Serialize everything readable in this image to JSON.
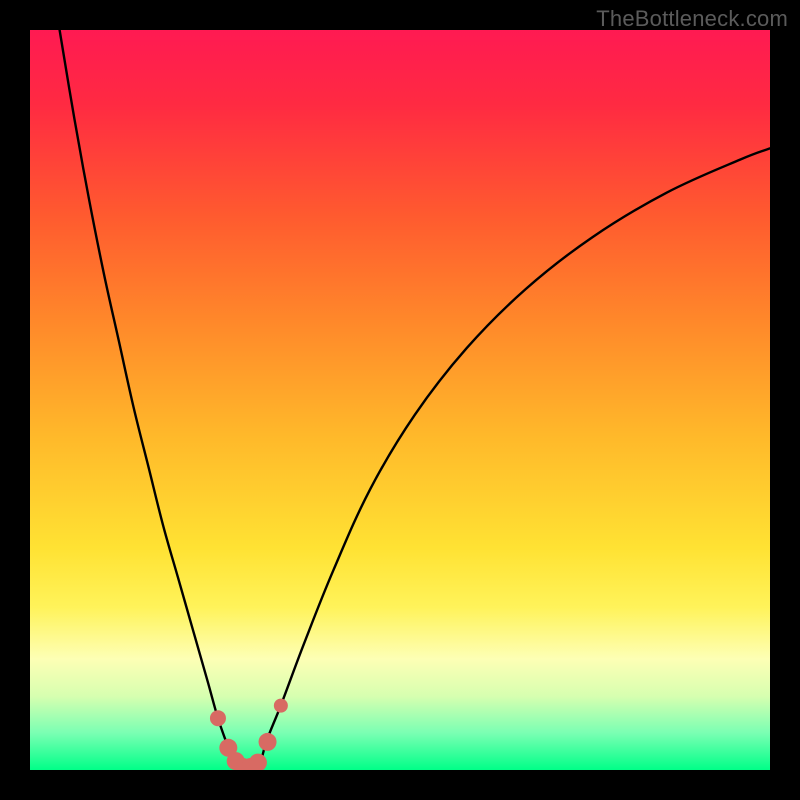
{
  "watermark": "TheBottleneck.com",
  "colors": {
    "frame": "#000000",
    "curve": "#000000",
    "marker": "#d86a63",
    "gradient_stops": [
      {
        "offset": 0.0,
        "color": "#ff1a52"
      },
      {
        "offset": 0.1,
        "color": "#ff2a42"
      },
      {
        "offset": 0.25,
        "color": "#ff5a2f"
      },
      {
        "offset": 0.4,
        "color": "#ff8a2a"
      },
      {
        "offset": 0.55,
        "color": "#ffb92a"
      },
      {
        "offset": 0.7,
        "color": "#ffe233"
      },
      {
        "offset": 0.78,
        "color": "#fff35a"
      },
      {
        "offset": 0.85,
        "color": "#fdffb5"
      },
      {
        "offset": 0.9,
        "color": "#d7ffb0"
      },
      {
        "offset": 0.95,
        "color": "#7affb3"
      },
      {
        "offset": 1.0,
        "color": "#00ff88"
      }
    ]
  },
  "chart_data": {
    "type": "line",
    "title": "",
    "xlabel": "",
    "ylabel": "",
    "xlim": [
      0,
      100
    ],
    "ylim": [
      0,
      100
    ],
    "series": [
      {
        "name": "left-branch",
        "x": [
          4,
          6,
          8,
          10,
          12,
          14,
          16,
          18,
          20,
          22,
          24,
          25.4,
          26.8,
          27.5
        ],
        "y": [
          100,
          88,
          77,
          67,
          58,
          49,
          41,
          33,
          26,
          19,
          12,
          7,
          3,
          1
        ]
      },
      {
        "name": "right-branch",
        "x": [
          31.2,
          32,
          34,
          37,
          41,
          46,
          52,
          59,
          67,
          76,
          86,
          96,
          100
        ],
        "y": [
          1,
          4,
          9,
          17,
          27,
          38,
          48,
          57,
          65,
          72,
          78,
          82.5,
          84
        ]
      },
      {
        "name": "valley-floor",
        "x": [
          27.5,
          28.5,
          29.5,
          30.5,
          31.2
        ],
        "y": [
          1,
          0.15,
          0.02,
          0.15,
          1
        ]
      }
    ],
    "markers": {
      "name": "highlight-dots",
      "x": [
        25.4,
        26.8,
        27.8,
        28.8,
        29.8,
        30.8,
        32.1,
        33.9
      ],
      "y": [
        7,
        3.0,
        1.2,
        0.4,
        0.4,
        1.0,
        3.8,
        8.7
      ],
      "r": [
        8,
        9,
        9,
        9,
        9,
        9,
        9,
        7
      ]
    }
  }
}
